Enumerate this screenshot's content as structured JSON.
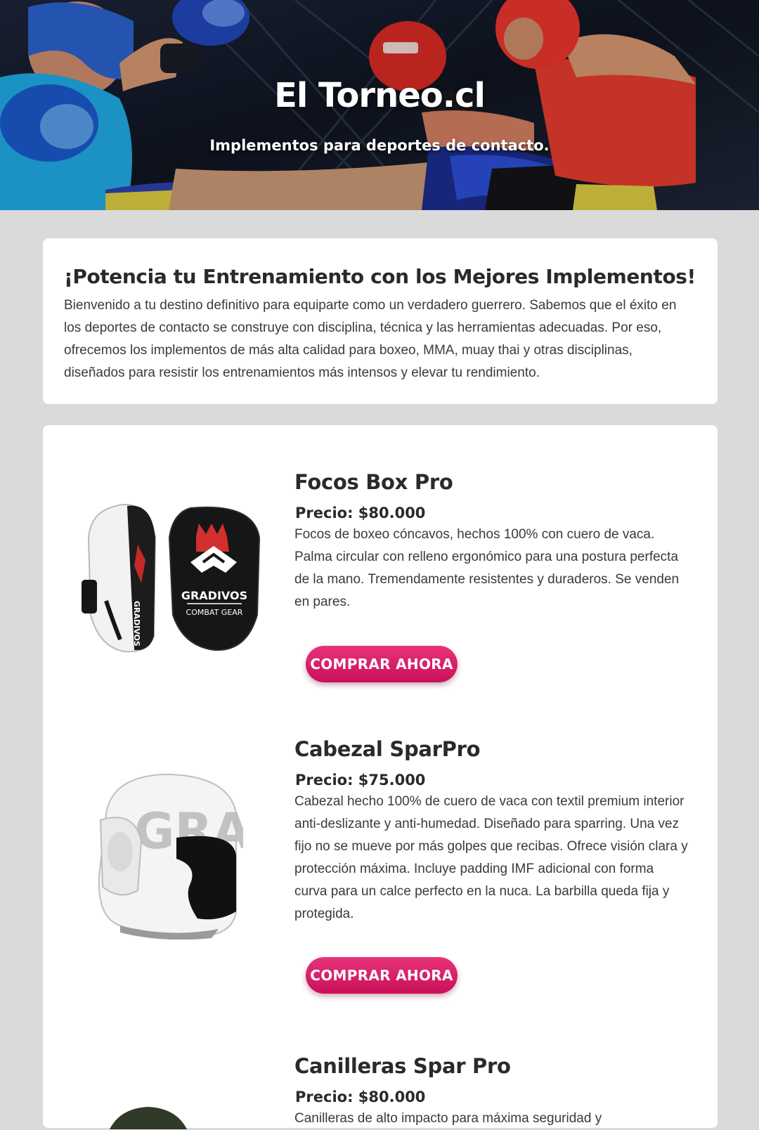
{
  "hero": {
    "title": "El Torneo.cl",
    "subtitle": "Implementos para deportes de contacto."
  },
  "intro": {
    "heading": "¡Potencia tu Entrenamiento con los Mejores Implementos!",
    "text": "Bienvenido a tu destino definitivo para equiparte como un verdadero guerrero. Sabemos que el éxito en los deportes de contacto se construye con disciplina, técnica y las herramientas adecuadas. Por eso, ofrecemos los implementos de más alta calidad para boxeo, MMA, muay thai y otras disciplinas, diseñados para resistir los entrenamientos más intensos y elevar tu rendimiento."
  },
  "products": [
    {
      "name": "Focos Box Pro",
      "price": "Precio: $80.000",
      "description": "Focos de boxeo cóncavos, hechos 100% con cuero de vaca. Palma circular con relleno ergonómico para una postura perfecta de la mano. Tremendamente resistentes y duraderos. Se venden en pares.",
      "button": "COMPRAR AHORA",
      "image_brand": "GRADIVOS",
      "image_brand_sub": "COMBAT GEAR"
    },
    {
      "name": "Cabezal SparPro",
      "price": "Precio: $75.000",
      "description": "Cabezal hecho 100% de cuero de vaca con textil premium interior anti-deslizante y anti-humedad. Diseñado para sparring. Una vez fijo no se mueve por más golpes que recibas. Ofrece visión clara y protección máxima. Incluye padding IMF adicional con forma curva para un calce perfecto en la nuca. La barbilla queda fija y protegida.",
      "button": "COMPRAR AHORA",
      "image_brand": "GRADI"
    },
    {
      "name": "Canilleras Spar Pro",
      "price": "Precio: $80.000",
      "description": "Canilleras de alto impacto para máxima seguridad y"
    }
  ],
  "colors": {
    "page_bg": "#dadada",
    "card_bg": "#ffffff",
    "button_accent": "#d81b60",
    "text": "#2a2a2a"
  }
}
